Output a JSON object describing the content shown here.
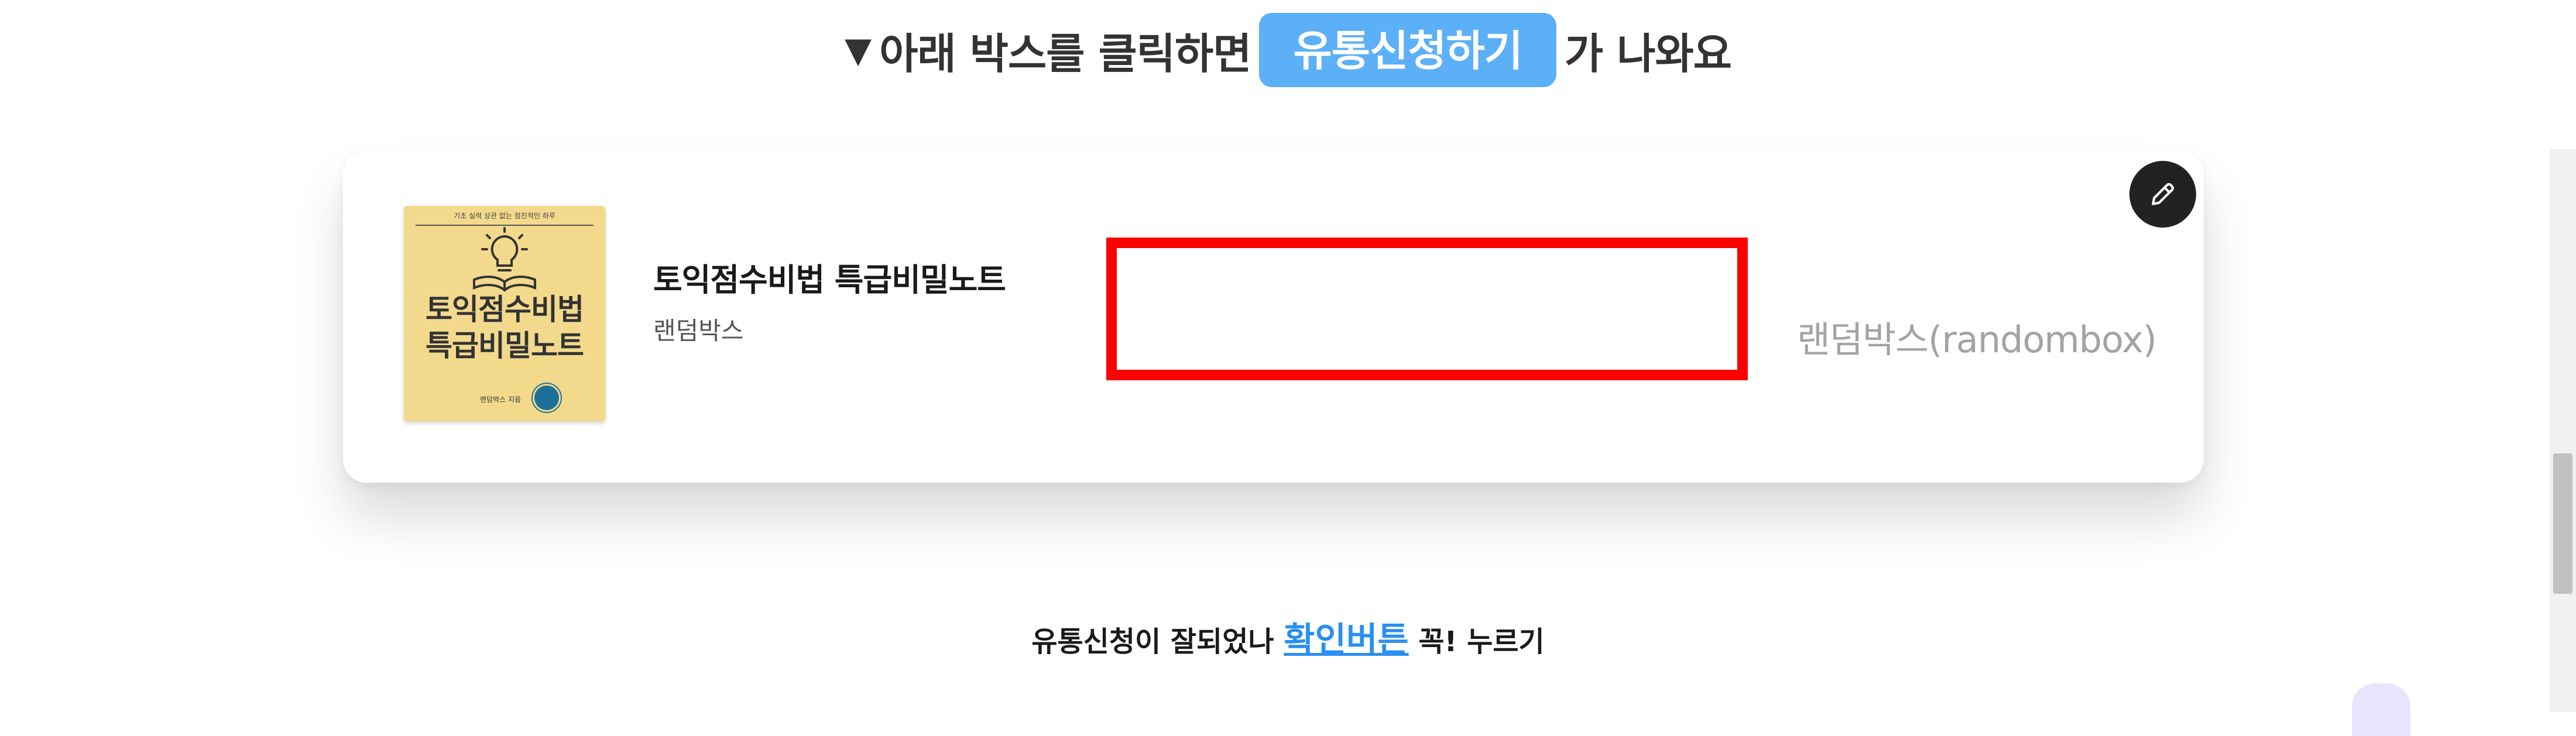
{
  "headline": {
    "arrow": "▼",
    "before": "아래 박스를 클릭하면",
    "highlight": "유통신청하기",
    "after": "가 나와요"
  },
  "card": {
    "edit_icon": "pencil-icon",
    "cover": {
      "top_caption": "기초 실력 상관 없는 점진적인 하루 ",
      "title_line1": "토익점수비법",
      "title_line2": "특급비밀노트",
      "publisher": "랜덤박스 지음"
    },
    "title": "토익점수비법 특급비밀노트",
    "subtitle": "랜덤박스",
    "brand": "랜덤박스(randombox)"
  },
  "confirm": {
    "before": "유통신청이 잘되었나 ",
    "link": "확인버튼",
    "after": " 꼭! 누르기"
  },
  "colors": {
    "accent": "#5cb0f7",
    "highlight_box": "#ff0000",
    "link": "#2a8ff0",
    "cover_bg": "#f2d98c"
  }
}
